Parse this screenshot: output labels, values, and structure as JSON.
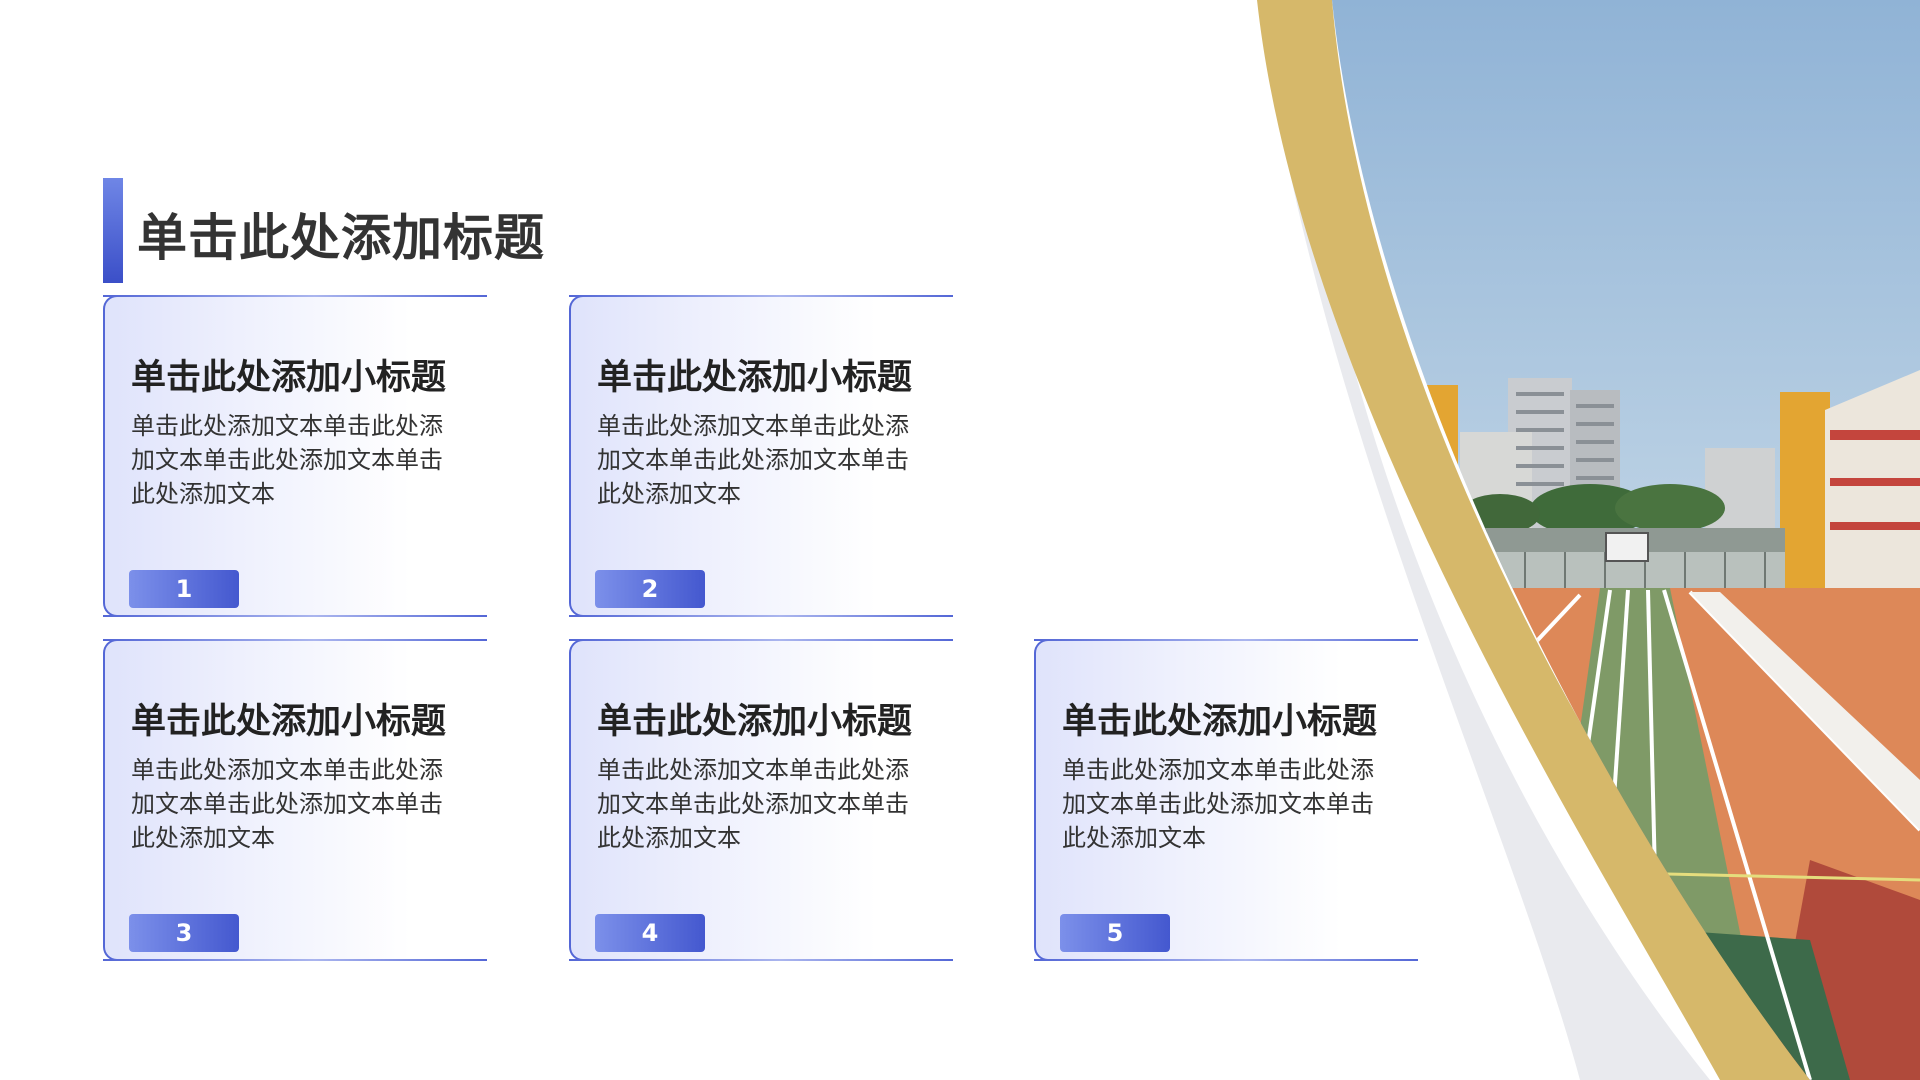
{
  "title": "单击此处添加标题",
  "cards": [
    {
      "number": "1",
      "subtitle": "单击此处添加小标题",
      "text": "单击此处添加文本单击此处添加文本单击此处添加文本单击此处添加文本"
    },
    {
      "number": "2",
      "subtitle": "单击此处添加小标题",
      "text": "单击此处添加文本单击此处添加文本单击此处添加文本单击此处添加文本"
    },
    {
      "number": "3",
      "subtitle": "单击此处添加小标题",
      "text": "单击此处添加文本单击此处添加文本单击此处添加文本单击此处添加文本"
    },
    {
      "number": "4",
      "subtitle": "单击此处添加小标题",
      "text": "单击此处添加文本单击此处添加文本单击此处添加文本单击此处添加文本"
    },
    {
      "number": "5",
      "subtitle": "单击此处添加小标题",
      "text": "单击此处添加文本单击此处添加文本单击此处添加文本单击此处添加文本"
    }
  ],
  "colors": {
    "accent": "#4458cf",
    "accent_light": "#7c90ea",
    "gold": "#d6b86a",
    "title_text": "#333333"
  },
  "photo": {
    "icon": "school-sports-field-image"
  }
}
